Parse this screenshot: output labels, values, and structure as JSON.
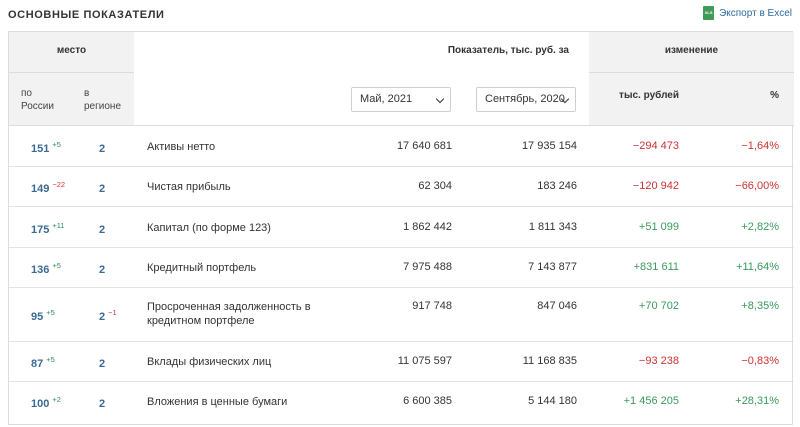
{
  "header": {
    "title": "ОСНОВНЫЕ ПОКАЗАТЕЛИ",
    "export_label": "Экспорт в Excel"
  },
  "columns": {
    "place": "место",
    "place_russia": "по\nРоссии",
    "place_region": "в\nрегионе",
    "indicator": "Показатель, тыс. руб. за",
    "change": "изменение",
    "change_rub": "тыс. рублей",
    "change_pct": "%"
  },
  "selects": {
    "period1": "Май, 2021",
    "period2": "Сентябрь, 2020"
  },
  "rows": [
    {
      "rank": "151",
      "rank_delta": "+5",
      "rank_dir": "up",
      "region": "2",
      "region_delta": "",
      "region_dir": "",
      "name": "Активы нетто",
      "v1": "17 640 681",
      "v2": "17 935 154",
      "diff": "−294 473",
      "pct": "−1,64%",
      "sign": "neg"
    },
    {
      "rank": "149",
      "rank_delta": "−22",
      "rank_dir": "down",
      "region": "2",
      "region_delta": "",
      "region_dir": "",
      "name": "Чистая прибыль",
      "v1": "62 304",
      "v2": "183 246",
      "diff": "−120 942",
      "pct": "−66,00%",
      "sign": "neg"
    },
    {
      "rank": "175",
      "rank_delta": "+11",
      "rank_dir": "up",
      "region": "2",
      "region_delta": "",
      "region_dir": "",
      "name": "Капитал (по форме 123)",
      "v1": "1 862 442",
      "v2": "1 811 343",
      "diff": "+51 099",
      "pct": "+2,82%",
      "sign": "pos"
    },
    {
      "rank": "136",
      "rank_delta": "+5",
      "rank_dir": "up",
      "region": "2",
      "region_delta": "",
      "region_dir": "",
      "name": "Кредитный портфель",
      "v1": "7 975 488",
      "v2": "7 143 877",
      "diff": "+831 611",
      "pct": "+11,64%",
      "sign": "pos"
    },
    {
      "rank": "95",
      "rank_delta": "+5",
      "rank_dir": "up",
      "region": "2",
      "region_delta": "−1",
      "region_dir": "down",
      "name": "Просроченная задолженность в кредитном портфеле",
      "v1": "917 748",
      "v2": "847 046",
      "diff": "+70 702",
      "pct": "+8,35%",
      "sign": "pos"
    },
    {
      "rank": "87",
      "rank_delta": "+5",
      "rank_dir": "up",
      "region": "2",
      "region_delta": "",
      "region_dir": "",
      "name": "Вклады физических лиц",
      "v1": "11 075 597",
      "v2": "11 168 835",
      "diff": "−93 238",
      "pct": "−0,83%",
      "sign": "neg"
    },
    {
      "rank": "100",
      "rank_delta": "+2",
      "rank_dir": "up",
      "region": "2",
      "region_delta": "",
      "region_dir": "",
      "name": "Вложения в ценные бумаги",
      "v1": "6 600 385",
      "v2": "5 144 180",
      "diff": "+1 456 205",
      "pct": "+28,31%",
      "sign": "pos"
    }
  ]
}
